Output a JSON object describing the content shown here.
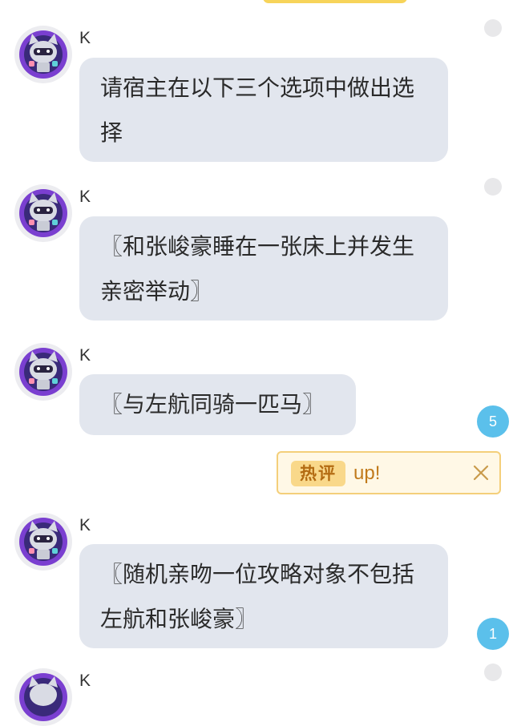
{
  "messages": [
    {
      "sender": "K",
      "text": "请宿主在以下三个选项中做出选择"
    },
    {
      "sender": "K",
      "text": "〖和张峻豪睡在一张床上并发生亲密举动〗"
    },
    {
      "sender": "K",
      "text": "〖与左航同骑一匹马〗"
    },
    {
      "sender": "K",
      "text": "〖随机亲吻一位攻略对象不包括左航和张峻豪〗"
    },
    {
      "sender": "K"
    }
  ],
  "comment_counts": [
    "5",
    "1"
  ],
  "hot_comment": {
    "tag": "热评",
    "text": "up!"
  },
  "icons": {
    "avatar": "robot-cat-avatar-icon",
    "close": "close-icon",
    "more_dot": "more-dot-icon"
  },
  "colors": {
    "bubble": "#e2e6ee",
    "badge": "#5bc0eb",
    "hot_border": "#f4cf7a",
    "hot_bg": "#fff8e6",
    "top_pill": "#f7d45a"
  }
}
